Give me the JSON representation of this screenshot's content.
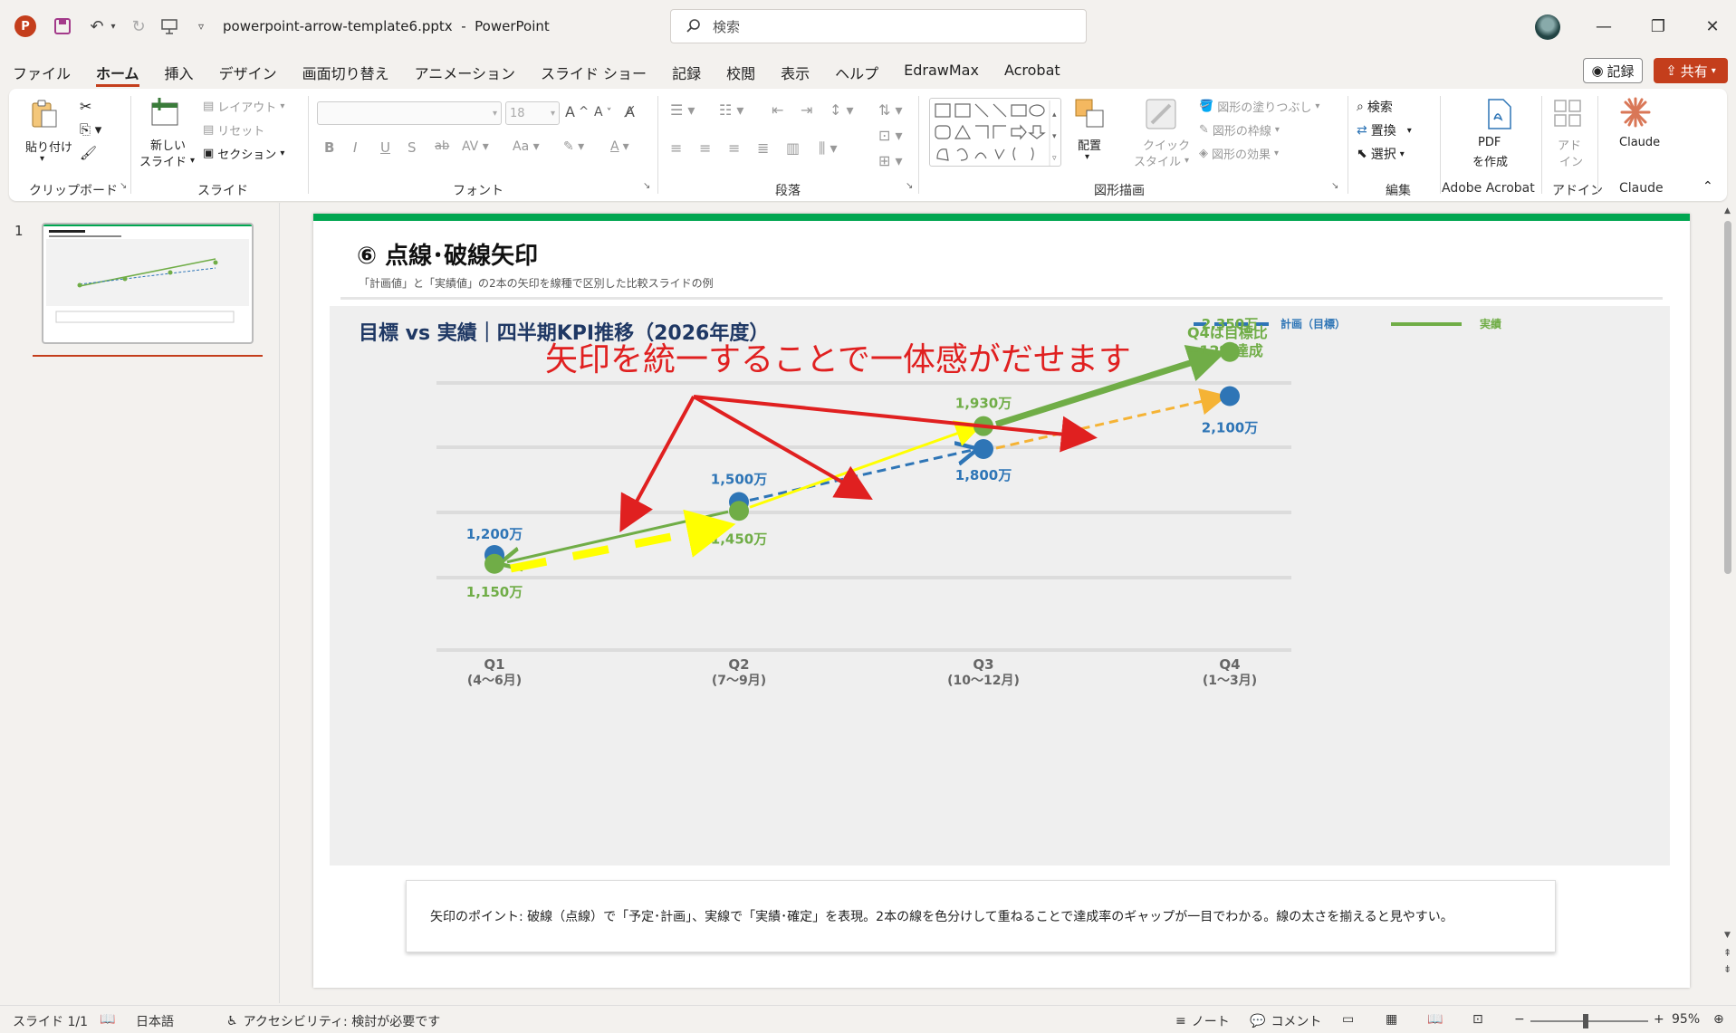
{
  "titlebar": {
    "filename": "powerpoint-arrow-template6.pptx",
    "separator": "-",
    "app_name": "PowerPoint",
    "search_placeholder": "検索"
  },
  "tabs": [
    "ファイル",
    "ホーム",
    "挿入",
    "デザイン",
    "画面切り替え",
    "アニメーション",
    "スライド ショー",
    "記録",
    "校閲",
    "表示",
    "ヘルプ",
    "EdrawMax",
    "Acrobat"
  ],
  "active_tab": "ホーム",
  "header_buttons": {
    "record": "記録",
    "share": "共有"
  },
  "ribbon": {
    "clipboard": {
      "paste": "貼り付け",
      "label": "クリップボード"
    },
    "slides": {
      "new_slide_1": "新しい",
      "new_slide_2": "スライド",
      "layout": "レイアウト",
      "reset": "リセット",
      "section": "セクション",
      "label": "スライド"
    },
    "font": {
      "size": "18",
      "label": "フォント"
    },
    "paragraph": {
      "label": "段落"
    },
    "drawing": {
      "arrange": "配置",
      "quick_style_1": "クイック",
      "quick_style_2": "スタイル",
      "fill": "図形の塗りつぶし",
      "outline": "図形の枠線",
      "effects": "図形の効果",
      "label": "図形描画"
    },
    "editing": {
      "find": "検索",
      "replace": "置換",
      "select": "選択",
      "label": "編集"
    },
    "acrobat": {
      "pdf_1": "PDF",
      "pdf_2": "を作成",
      "label": "Adobe Acrobat"
    },
    "addins": {
      "btn_1": "アド",
      "btn_2": "イン",
      "label": "アドイン"
    },
    "claude": {
      "btn": "Claude",
      "label": "Claude"
    }
  },
  "thumbnail": {
    "number": "1"
  },
  "slide": {
    "title": "⑥ 点線･破線矢印",
    "subtitle": "「計画値」と「実績値」の2本の矢印を線種で区別した比較スライドの例",
    "chart_title": "目標 vs 実績｜四半期KPI推移（2026年度）",
    "legend_plan": "計画（目標）",
    "legend_actual": "実績",
    "annotation": "矢印を統一することで一体感がだせます",
    "q4_callout_1": "Q4は目標比",
    "q4_callout_2": "+12%達成",
    "note": "矢印のポイント: 破線（点線）で「予定･計画」、実線で「実績･確定」を表現。2本の線を色分けして重ねることで達成率のギャップが一目でわかる。線の太さを揃えると見やすい。"
  },
  "chart_data": {
    "type": "line",
    "categories": [
      "Q1\n(4〜6月)",
      "Q2\n(7〜9月)",
      "Q3\n(10〜12月)",
      "Q4\n(1〜3月)"
    ],
    "category_labels": [
      {
        "q": "Q1",
        "m": "(4〜6月)"
      },
      {
        "q": "Q2",
        "m": "(7〜9月)"
      },
      {
        "q": "Q3",
        "m": "(10〜12月)"
      },
      {
        "q": "Q4",
        "m": "(1〜3月)"
      }
    ],
    "series": [
      {
        "name": "計画（目標）",
        "values": [
          1200,
          1500,
          1800,
          2100
        ],
        "labels": [
          "1,200万",
          "1,500万",
          "1,800万",
          "2,100万"
        ],
        "color": "#2e75b6"
      },
      {
        "name": "実績",
        "values": [
          1150,
          1450,
          1930,
          2350
        ],
        "labels": [
          "1,150万",
          "1,450万",
          "1,930万",
          "2,350万"
        ],
        "color": "#70ad47"
      }
    ],
    "ylim": [
      900,
      2500
    ],
    "grid": true,
    "legend": "top-right"
  },
  "colors": {
    "plan": "#2e75b6",
    "actual": "#70ad47",
    "annotation_red": "#e02020",
    "highlight_yellow": "#ffff00",
    "orange_dash": "#f5b335",
    "accent_bar": "#00a651",
    "brand": "#c43e1c"
  },
  "statusbar": {
    "slide_info": "スライド 1/1",
    "language": "日本語",
    "accessibility": "アクセシビリティ: 検討が必要です",
    "notes": "ノート",
    "comments": "コメント",
    "zoom": "95%"
  }
}
